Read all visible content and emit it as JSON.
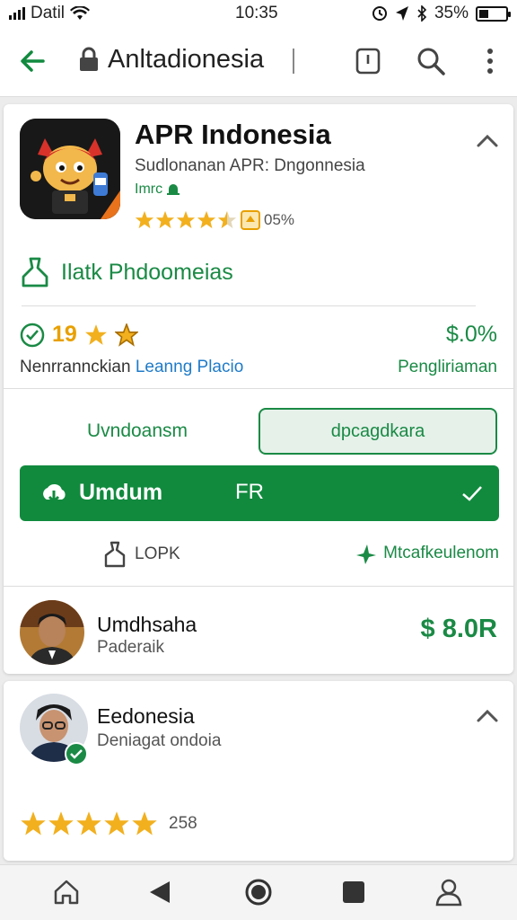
{
  "status_bar": {
    "carrier": "Datil",
    "time": "10:35",
    "battery": "35%",
    "battery_level": 0.35
  },
  "app_bar": {
    "title": "Anltadionesia"
  },
  "app": {
    "name": "APR Indonesia",
    "subtitle": "Sudlonanan APR: Dngonnesia",
    "developer": "Imrc",
    "rating_value": 4.5,
    "rating_text": "05%"
  },
  "link": {
    "label": "Ilatk Phdoomeias"
  },
  "stats": {
    "left_value": "19",
    "right_value": "$.0%",
    "left_label": "Nenrrannckian",
    "left_label_accent": "Leanng Placio",
    "right_label": "Pengliriaman"
  },
  "tabs": {
    "left": "Uvndoansm",
    "right": "dpcagdkara"
  },
  "install_button": {
    "label": "Umdum",
    "price": "FR"
  },
  "actions": {
    "left": "LOPK",
    "right": "Mtcafkeulenom"
  },
  "seller": {
    "name": "Umdhsaha",
    "role": "Paderaik",
    "price": "$ 8.0R"
  },
  "review": {
    "name": "Eedonesia",
    "subtitle": "Deniagat ondoia",
    "rating_value": 5,
    "count": "258"
  },
  "colors": {
    "accent_green": "#118a3e",
    "star_gold": "#f2b01e"
  },
  "nav": {
    "items": [
      "home-icon",
      "back-icon",
      "home-circle-icon",
      "recents-icon",
      "profile-icon"
    ]
  }
}
